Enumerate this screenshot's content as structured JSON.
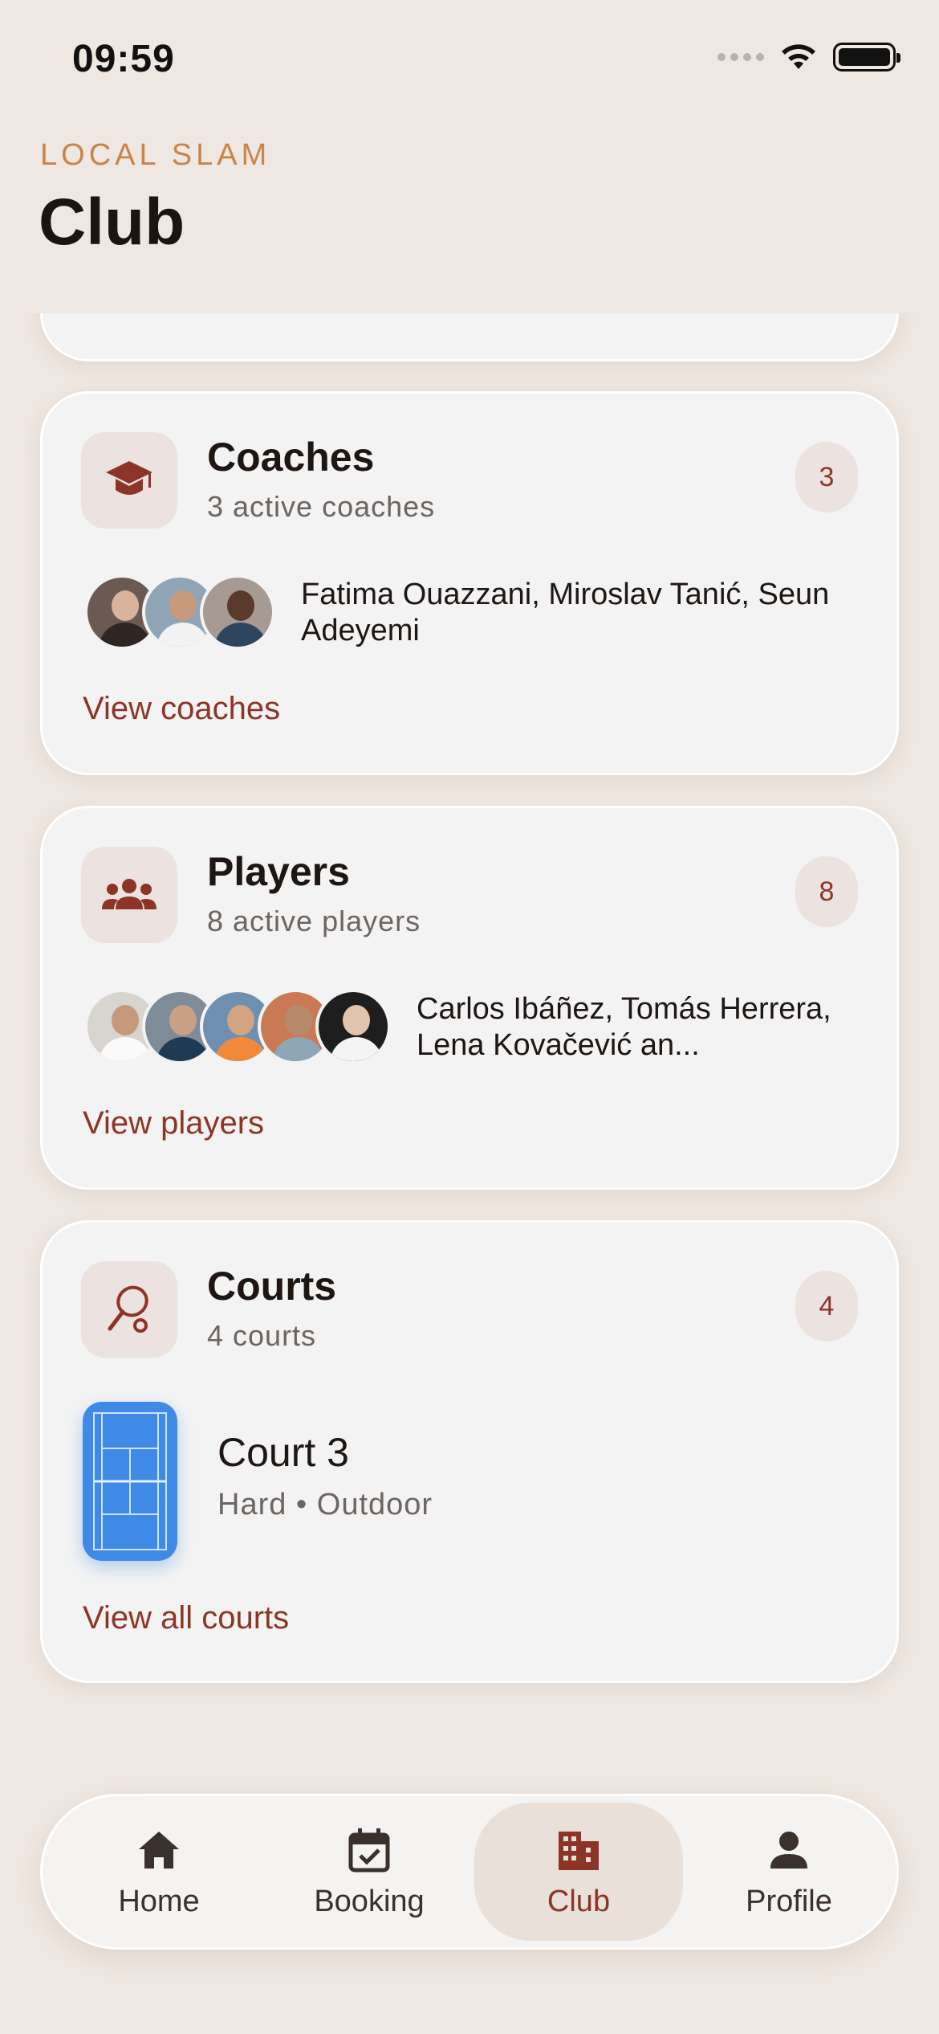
{
  "status_bar": {
    "time": "09:59"
  },
  "header": {
    "eyebrow": "LOCAL SLAM",
    "title": "Club"
  },
  "coaches": {
    "title": "Coaches",
    "subtitle": "3 active coaches",
    "count": "3",
    "names": "Fatima Ouazzani, Miroslav Tanić, Seun Adeyemi",
    "link": "View coaches"
  },
  "players": {
    "title": "Players",
    "subtitle": "8 active players",
    "count": "8",
    "names": "Carlos Ibáñez, Tomás Herrera, Lena Kovačević an...",
    "link": "View players"
  },
  "courts": {
    "title": "Courts",
    "subtitle": "4 courts",
    "count": "4",
    "court_name": "Court 3",
    "court_meta": "Hard • Outdoor",
    "link": "View all courts"
  },
  "tabs": [
    {
      "label": "Home",
      "icon": "home-icon"
    },
    {
      "label": "Booking",
      "icon": "calendar-check-icon"
    },
    {
      "label": "Club",
      "icon": "building-icon",
      "active": true
    },
    {
      "label": "Profile",
      "icon": "person-icon"
    }
  ],
  "colors": {
    "background": "#efe7e1",
    "accent": "#8c3526",
    "eyebrow": "#c98549",
    "court": "#3f8ae6"
  }
}
